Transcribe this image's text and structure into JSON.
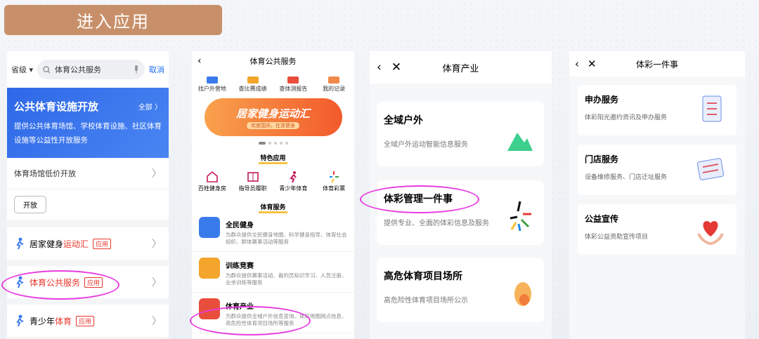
{
  "banner_title": "进入应用",
  "p1": {
    "region": "省级",
    "search_value": "体育公共服务",
    "cancel": "取消",
    "blue_title": "公共体育设施开放",
    "blue_all": "全部",
    "blue_desc": "提供公共体育场馆、学校体育设施、社区体育设施等公益性开放服务",
    "venue_row": "体育场馆低价开放",
    "open_btn": "开放",
    "items": [
      {
        "pre": "居家健身",
        "hl": "运动汇",
        "tag": "应用"
      },
      {
        "pre": "",
        "hl": "体育公共服务",
        "tag": "应用"
      },
      {
        "pre": "青少年",
        "hl": "体育",
        "tag": "应用"
      }
    ]
  },
  "p2": {
    "title": "体育公共服务",
    "quick": [
      "找户外营地",
      "查比赛成绩",
      "查体测报告",
      "我的记录"
    ],
    "banner_main": "居家健身运动汇",
    "banner_sub": "欢度国庆，在浙健身",
    "feat_title": "特色应用",
    "feat": [
      "百姓健身房",
      "指导员履职",
      "青少年体育",
      "体育彩票"
    ],
    "svc_title": "体育服务",
    "svc": [
      {
        "name": "全民健身",
        "desc": "为群众提供全民健身地图、科学健身指导、体育社会组织、群体赛事活动等服务"
      },
      {
        "name": "训练竞赛",
        "desc": "为群众提供赛事活动、裁判员知识学习、人员注册、业余训练等服务"
      },
      {
        "name": "体育产业",
        "desc": "为群众提供全域户外信息查询、体彩地图网点信息、高危险性体育项目场所等服务"
      }
    ]
  },
  "p3": {
    "title": "体育产业",
    "cards": [
      {
        "name": "全域户外",
        "desc": "全域户外运动智能信息服务"
      },
      {
        "name": "体彩管理一件事",
        "desc": "提供专业、全面的体彩信息及服务"
      },
      {
        "name": "高危体育项目场所",
        "desc": "高危险性体育项目场所公示"
      }
    ]
  },
  "p4": {
    "title": "体彩一件事",
    "cards": [
      {
        "name": "申办服务",
        "desc": "体彩阳光邀约资讯及申办服务"
      },
      {
        "name": "门店服务",
        "desc": "设备维修服务、门店迁址服务"
      },
      {
        "name": "公益宣传",
        "desc": "体彩公益资助宣传项目"
      }
    ]
  },
  "colors": {
    "accent_blue": "#2e68e8",
    "highlight_red": "#e8362b",
    "annotation_pink": "#e83be0",
    "banner_brown": "#c8906a"
  }
}
